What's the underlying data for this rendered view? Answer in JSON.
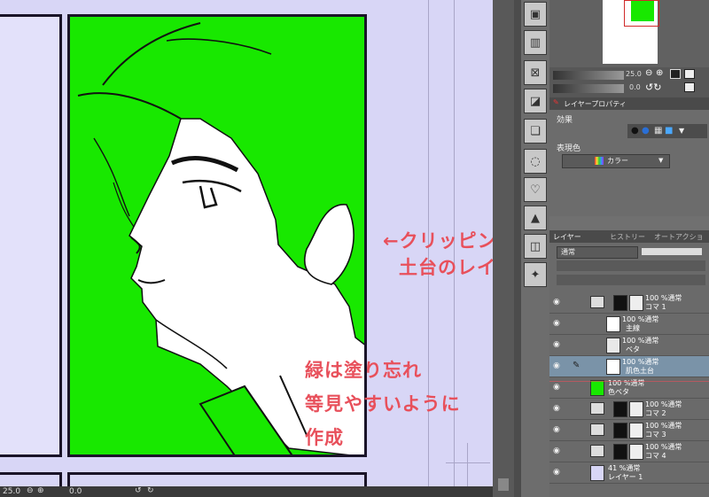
{
  "annotations": {
    "line1": "←クリッピング用に",
    "line2": "土台のレイヤーを作成",
    "line3": "緑は塗り忘れ",
    "line4": "等見やすいように",
    "line5": "作成",
    "arrow": "→"
  },
  "status_bar": {
    "zoom": "25.0",
    "rotation": "0.0"
  },
  "navigator": {
    "zoom": "25.0",
    "rotation": "0.0"
  },
  "layer_property": {
    "tab_label": "レイヤープロパティ",
    "effect_label": "効果",
    "expression_color_label": "表現色",
    "expression_color_value": "カラー"
  },
  "layer_panel": {
    "tabs": [
      "レイヤー",
      "ヒストリー",
      "オートアクション"
    ],
    "blend_mode": "通常",
    "layers": [
      {
        "mode": "100 %通常",
        "name": "コマ 1",
        "type": "folder"
      },
      {
        "mode": "100 %通常",
        "name": "主線",
        "type": "raster"
      },
      {
        "mode": "100 %通常",
        "name": "ベタ",
        "type": "raster"
      },
      {
        "mode": "100 %通常",
        "name": "肌色土台",
        "type": "raster",
        "selected": true
      },
      {
        "mode": "100 %通常",
        "name": "色ベタ",
        "type": "fill"
      },
      {
        "mode": "100 %通常",
        "name": "コマ 2",
        "type": "folder"
      },
      {
        "mode": "100 %通常",
        "name": "コマ 3",
        "type": "folder"
      },
      {
        "mode": "100 %通常",
        "name": "コマ 4",
        "type": "folder"
      },
      {
        "mode": "41 %通常",
        "name": "レイヤー 1",
        "type": "raster"
      }
    ]
  },
  "colors": {
    "canvas_bg": "#d8d6f6",
    "panel_fill": "#18e800",
    "annotation": "#e8505b",
    "selected_layer": "#7a93a8"
  },
  "icons": [
    "eye-icon",
    "folder-icon",
    "mask-icon",
    "clip-icon",
    "chevron-down-icon"
  ]
}
